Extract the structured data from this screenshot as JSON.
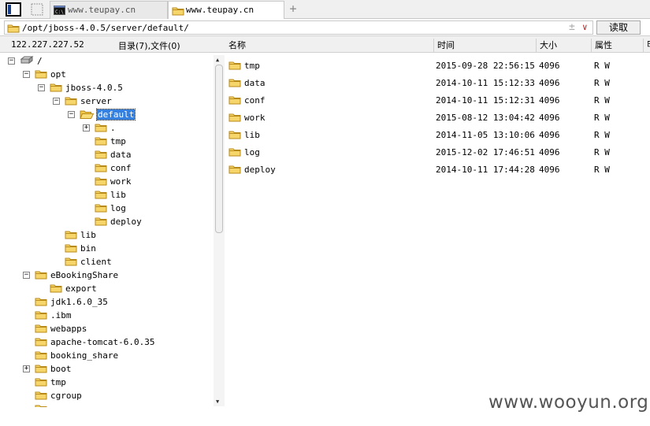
{
  "tabs": [
    {
      "label": "www.teupay.cn",
      "icon": "terminal-icon",
      "active": false
    },
    {
      "label": "www.teupay.cn",
      "icon": "folder-icon",
      "active": true
    }
  ],
  "new_tab_label": "+",
  "address": {
    "value": "/opt/jboss-4.0.5/server/default/",
    "pm": "±",
    "chevron": "∨"
  },
  "read_button": "读取",
  "info": {
    "host": "122.227.227.52",
    "counts": "目录(7),文件(0)"
  },
  "columns": {
    "name": "名称",
    "time": "时间",
    "size": "大小",
    "attr": "属性",
    "extra": "⊟"
  },
  "tree": [
    {
      "label": "/",
      "expander": "−",
      "kind": "drive",
      "selected": false
    },
    {
      "label": "opt",
      "expander": "−",
      "kind": "folder",
      "selected": false
    },
    {
      "label": "jboss-4.0.5",
      "expander": "−",
      "kind": "folder",
      "selected": false
    },
    {
      "label": "server",
      "expander": "−",
      "kind": "folder",
      "selected": false
    },
    {
      "label": "default",
      "expander": "−",
      "kind": "folder-open",
      "selected": true
    },
    {
      "label": ".",
      "expander": "+",
      "kind": "folder",
      "selected": false
    },
    {
      "label": "tmp",
      "expander": "",
      "kind": "folder",
      "selected": false
    },
    {
      "label": "data",
      "expander": "",
      "kind": "folder",
      "selected": false
    },
    {
      "label": "conf",
      "expander": "",
      "kind": "folder",
      "selected": false
    },
    {
      "label": "work",
      "expander": "",
      "kind": "folder",
      "selected": false
    },
    {
      "label": "lib",
      "expander": "",
      "kind": "folder",
      "selected": false
    },
    {
      "label": "log",
      "expander": "",
      "kind": "folder",
      "selected": false
    },
    {
      "label": "deploy",
      "expander": "",
      "kind": "folder",
      "selected": false
    },
    {
      "label": "lib",
      "expander": "",
      "kind": "folder",
      "selected": false
    },
    {
      "label": "bin",
      "expander": "",
      "kind": "folder",
      "selected": false
    },
    {
      "label": "client",
      "expander": "",
      "kind": "folder",
      "selected": false
    },
    {
      "label": "eBookingShare",
      "expander": "−",
      "kind": "folder",
      "selected": false
    },
    {
      "label": "export",
      "expander": "",
      "kind": "folder",
      "selected": false
    },
    {
      "label": "jdk1.6.0_35",
      "expander": "",
      "kind": "folder",
      "selected": false
    },
    {
      "label": ".ibm",
      "expander": "",
      "kind": "folder",
      "selected": false
    },
    {
      "label": "webapps",
      "expander": "",
      "kind": "folder",
      "selected": false
    },
    {
      "label": "apache-tomcat-6.0.35",
      "expander": "",
      "kind": "folder",
      "selected": false
    },
    {
      "label": "booking_share",
      "expander": "",
      "kind": "folder",
      "selected": false
    },
    {
      "label": "boot",
      "expander": "+",
      "kind": "folder",
      "selected": false
    },
    {
      "label": "tmp",
      "expander": "",
      "kind": "folder",
      "selected": false
    },
    {
      "label": "cgroup",
      "expander": "",
      "kind": "folder",
      "selected": false
    },
    {
      "label": "",
      "expander": "",
      "kind": "folder",
      "selected": false
    }
  ],
  "files": [
    {
      "name": "tmp",
      "time": "2015-09-28 22:56:15",
      "size": "4096",
      "attr": "R W"
    },
    {
      "name": "data",
      "time": "2014-10-11 15:12:33",
      "size": "4096",
      "attr": "R W"
    },
    {
      "name": "conf",
      "time": "2014-10-11 15:12:31",
      "size": "4096",
      "attr": "R W"
    },
    {
      "name": "work",
      "time": "2015-08-12 13:04:42",
      "size": "4096",
      "attr": "R W"
    },
    {
      "name": "lib",
      "time": "2014-11-05 13:10:06",
      "size": "4096",
      "attr": "R W"
    },
    {
      "name": "log",
      "time": "2015-12-02 17:46:51",
      "size": "4096",
      "attr": "R W"
    },
    {
      "name": "deploy",
      "time": "2014-10-11 17:44:28",
      "size": "4096",
      "attr": "R W"
    }
  ],
  "watermark": "www.wooyun.org"
}
